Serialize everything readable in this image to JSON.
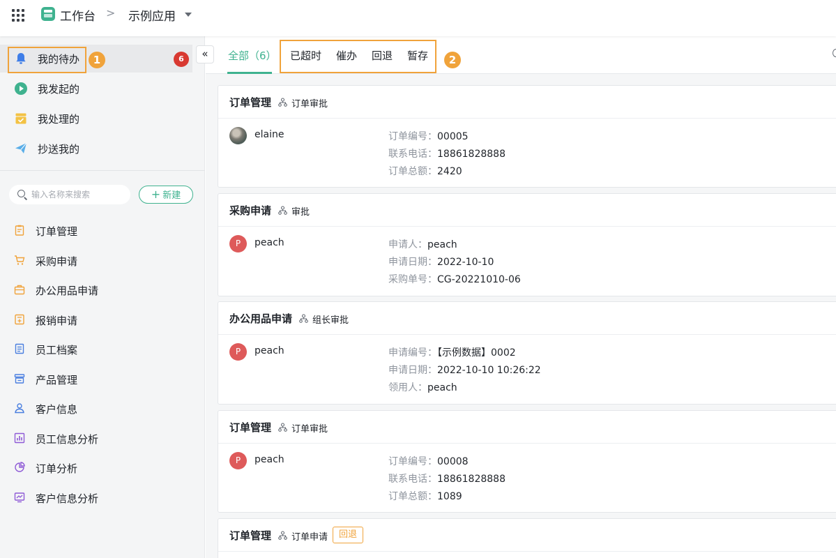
{
  "topbar": {
    "title": "工作台",
    "separator": ">",
    "app_name": "示例应用"
  },
  "sidebar": {
    "todo_items": [
      {
        "label": "我的待办",
        "icon": "bell-icon",
        "active": true
      },
      {
        "label": "我发起的",
        "icon": "play-circle-icon"
      },
      {
        "label": "我处理的",
        "icon": "inbox-check-icon"
      },
      {
        "label": "抄送我的",
        "icon": "paper-plane-icon"
      }
    ],
    "todo_count": "6",
    "callout_1": "1",
    "collapse": "«",
    "search_placeholder": "输入名称来搜索",
    "new_button": "新建",
    "forms": [
      {
        "label": "订单管理",
        "icon": "clipboard-icon"
      },
      {
        "label": "采购申请",
        "icon": "cart-icon"
      },
      {
        "label": "办公用品申请",
        "icon": "briefcase-icon"
      },
      {
        "label": "报销申请",
        "icon": "calculator-icon"
      },
      {
        "label": "员工档案",
        "icon": "document-icon"
      },
      {
        "label": "产品管理",
        "icon": "store-icon"
      },
      {
        "label": "客户信息",
        "icon": "user-icon"
      },
      {
        "label": "员工信息分析",
        "icon": "bar-chart-icon"
      },
      {
        "label": "订单分析",
        "icon": "pie-chart-icon"
      },
      {
        "label": "客户信息分析",
        "icon": "line-chart-icon"
      }
    ],
    "colors": {
      "accent": "#3fb28f",
      "badge": "#d83931",
      "highlight": "#f0a33b"
    }
  },
  "main": {
    "tabs": [
      {
        "label": "全部（6）",
        "active": true
      },
      {
        "label": "已超时"
      },
      {
        "label": "催办"
      },
      {
        "label": "回退"
      },
      {
        "label": "暂存"
      }
    ],
    "callout_2": "2",
    "cards": [
      {
        "title": "订单管理",
        "node": "订单审批",
        "user": "elaine",
        "avatar": "photo",
        "fields": [
          {
            "k": "订单编号：",
            "v": "00005"
          },
          {
            "k": "联系电话：",
            "v": "18861828888"
          },
          {
            "k": "订单总额：",
            "v": "2420"
          }
        ]
      },
      {
        "title": "采购申请",
        "node": "审批",
        "user": "peach",
        "avatar": "P",
        "fields": [
          {
            "k": "申请人：",
            "v": "peach"
          },
          {
            "k": "申请日期：",
            "v": "2022-10-10"
          },
          {
            "k": "采购单号：",
            "v": "CG-20221010-06"
          }
        ]
      },
      {
        "title": "办公用品申请",
        "node": "组长审批",
        "user": "peach",
        "avatar": "P",
        "fields": [
          {
            "k": "申请编号：",
            "v": "【示例数据】0002"
          },
          {
            "k": "申请日期：",
            "v": "2022-10-10 10:26:22"
          },
          {
            "k": "领用人：",
            "v": "peach"
          }
        ]
      },
      {
        "title": "订单管理",
        "node": "订单审批",
        "user": "peach",
        "avatar": "P",
        "fields": [
          {
            "k": "订单编号：",
            "v": "00008"
          },
          {
            "k": "联系电话：",
            "v": "18861828888"
          },
          {
            "k": "订单总额：",
            "v": "1089"
          }
        ]
      },
      {
        "title": "订单管理",
        "node": "订单申请",
        "tag": "回退"
      }
    ]
  }
}
